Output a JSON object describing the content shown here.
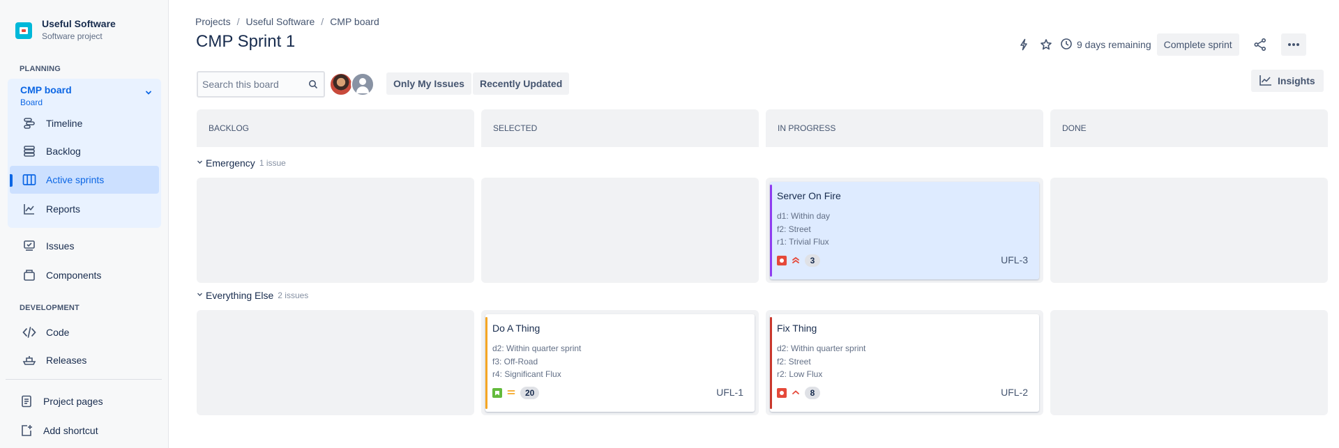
{
  "project": {
    "name": "Useful Software",
    "type": "Software project"
  },
  "sidebar": {
    "planning_label": "PLANNING",
    "board": {
      "title": "CMP board",
      "subtitle": "Board"
    },
    "planning_items": [
      {
        "label": "Timeline",
        "icon": "timeline-icon"
      },
      {
        "label": "Backlog",
        "icon": "backlog-icon"
      },
      {
        "label": "Active sprints",
        "icon": "board-columns-icon",
        "active": true
      },
      {
        "label": "Reports",
        "icon": "reports-chart-icon"
      }
    ],
    "other_items": [
      {
        "label": "Issues",
        "icon": "issues-icon"
      },
      {
        "label": "Components",
        "icon": "components-icon"
      }
    ],
    "development_label": "DEVELOPMENT",
    "development_items": [
      {
        "label": "Code",
        "icon": "code-icon"
      },
      {
        "label": "Releases",
        "icon": "releases-icon"
      }
    ],
    "footer_items": [
      {
        "label": "Project pages",
        "icon": "page-icon"
      },
      {
        "label": "Add shortcut",
        "icon": "add-shortcut-icon"
      }
    ]
  },
  "breadcrumb": [
    "Projects",
    "Useful Software",
    "CMP board"
  ],
  "page_title": "CMP Sprint 1",
  "header_actions": {
    "remaining": "9 days remaining",
    "complete_sprint": "Complete sprint"
  },
  "toolbar": {
    "search_placeholder": "Search this board",
    "filters": [
      "Only My Issues",
      "Recently Updated"
    ],
    "insights": "Insights"
  },
  "columns": [
    "BACKLOG",
    "SELECTED",
    "IN PROGRESS",
    "DONE"
  ],
  "swimlanes": [
    {
      "name": "Emergency",
      "count": "1 issue",
      "cards": [
        {
          "column": "IN PROGRESS",
          "title": "Server On Fire",
          "fields": [
            "d1: Within day",
            "f2: Street",
            "r1: Trivial Flux"
          ],
          "type": "bug",
          "priority": "highest",
          "points": "3",
          "key": "UFL-3",
          "stripe_color": "#8f3cf0",
          "selected": true
        }
      ]
    },
    {
      "name": "Everything Else",
      "count": "2 issues",
      "cards": [
        {
          "column": "SELECTED",
          "title": "Do A Thing",
          "fields": [
            "d2: Within quarter sprint",
            "f3: Off-Road",
            "r4: Significant Flux"
          ],
          "type": "story",
          "priority": "medium",
          "points": "20",
          "key": "UFL-1",
          "stripe_color": "#f5a623"
        },
        {
          "column": "IN PROGRESS",
          "title": "Fix Thing",
          "fields": [
            "d2: Within quarter sprint",
            "f2: Street",
            "r2: Low Flux"
          ],
          "type": "bug",
          "priority": "high",
          "points": "8",
          "key": "UFL-2",
          "stripe_color": "#c9372c"
        }
      ]
    }
  ]
}
